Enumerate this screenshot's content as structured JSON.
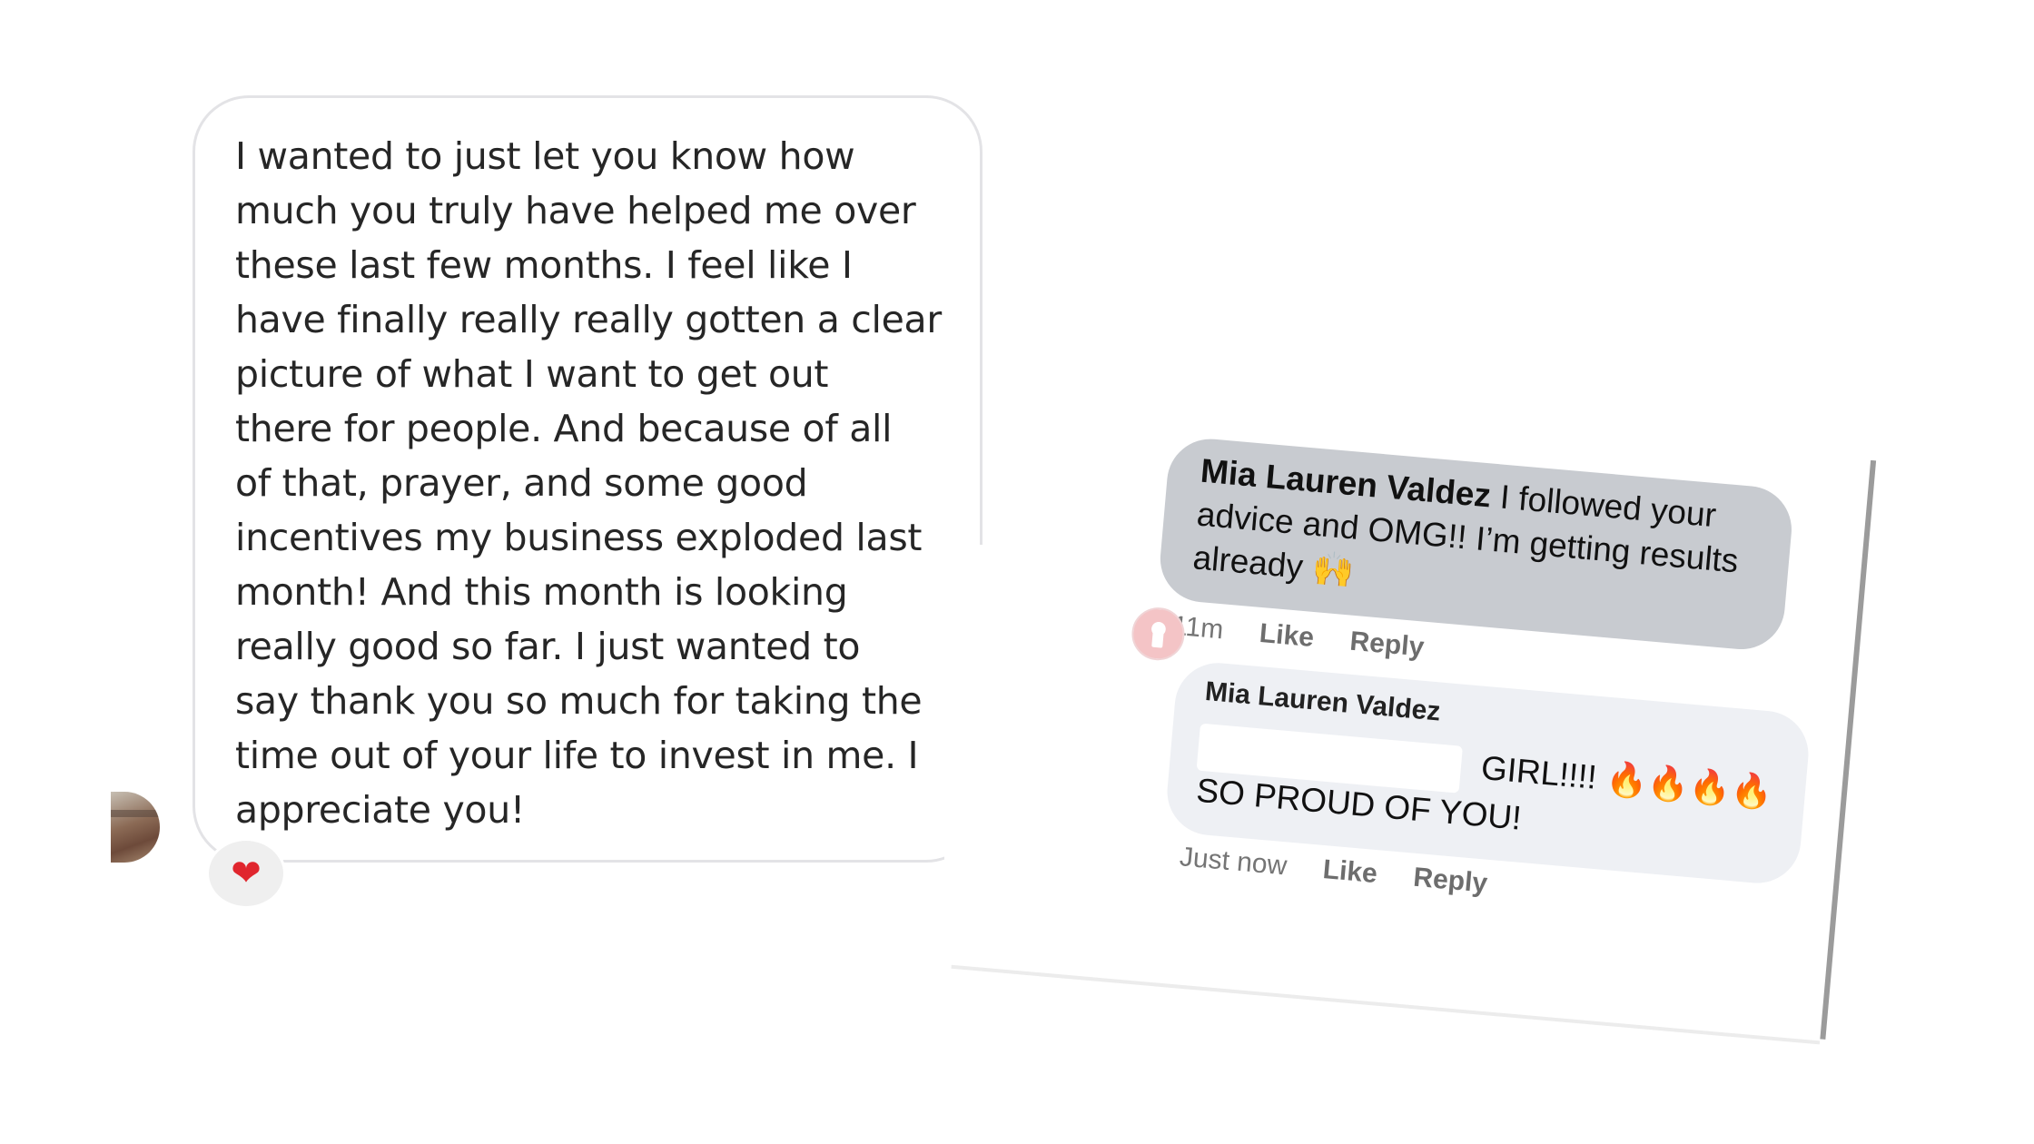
{
  "dm": {
    "message": "I wanted to just let you know how\nmuch you truly have helped me over\nthese last few months. I feel like I\nhave finally really really gotten a clear\npicture of what I want to get out\nthere for people. And because of all\nof that, prayer, and some good\nincentives my business exploded last\nmonth! And this month is looking\nreally good so far. I just wanted to\nsay thank you so much for taking the\ntime out of your life to invest in me. I\nappreciate you!",
    "reaction_icon": "heart",
    "reaction_glyph": "❤"
  },
  "fb": {
    "comment1": {
      "author": "Mia Lauren Valdez",
      "text": "I followed your advice and OMG!! I’m getting results already",
      "emoji": "🙌",
      "time": "11m",
      "like": "Like",
      "reply": "Reply"
    },
    "comment2": {
      "author": "Mia Lauren Valdez",
      "text_pre": "GIRL!!!!",
      "emoji": "🔥🔥🔥🔥",
      "text_post": "SO PROUD OF YOU!",
      "time": "Just now",
      "like": "Like",
      "reply": "Reply"
    },
    "colors": {
      "comment_grey": "#c8cbd0",
      "comment_light": "#eef0f4",
      "meta": "#757575"
    }
  }
}
